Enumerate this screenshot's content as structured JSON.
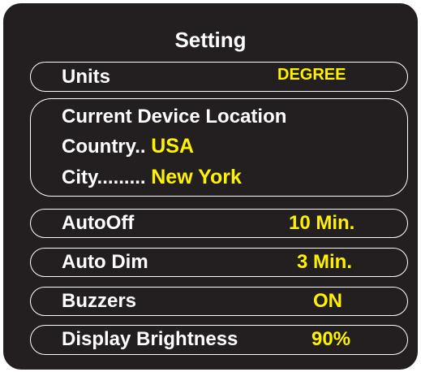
{
  "title": "Setting",
  "units": {
    "label": "Units",
    "value": "DEGREE"
  },
  "location": {
    "header": "Current Device Location",
    "country_label": "Country..",
    "country_value": "USA",
    "city_label": "City.........",
    "city_value": "New York"
  },
  "auto_off": {
    "label": "AutoOff",
    "value": "10 Min."
  },
  "auto_dim": {
    "label": "Auto Dim",
    "value": "3 Min."
  },
  "buzzers": {
    "label": "Buzzers",
    "value": "ON"
  },
  "display_brightness": {
    "label": "Display Brightness",
    "value": "90%"
  },
  "colors": {
    "background": "#231f20",
    "label_text": "#ffffff",
    "value_text": "#fff200",
    "border": "#ffffff"
  }
}
